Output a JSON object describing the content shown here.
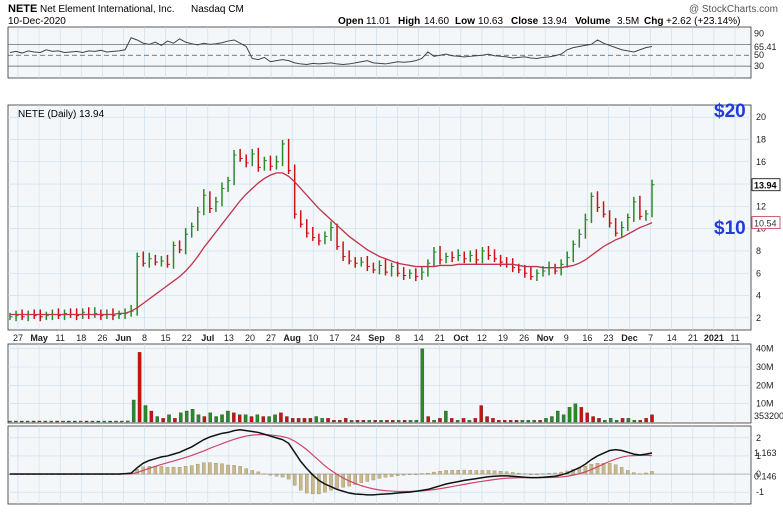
{
  "header": {
    "symbol": "NETE",
    "company": "Net Element International, Inc.",
    "exchange": "Nasdaq CM",
    "date": "10-Dec-2020",
    "open_label": "Open",
    "open": "11.01",
    "high_label": "High",
    "high": "14.60",
    "low_label": "Low",
    "low": "10.63",
    "close_label": "Close",
    "close": "13.94",
    "volume_label": "Volume",
    "volume": "3.5M",
    "chg_label": "Chg",
    "chg": "+2.62 (+23.14%)",
    "brand": "@ StockCharts.com"
  },
  "colors": {
    "up": "#2a8a2a",
    "down": "#cc1111",
    "ma": "#c0334a",
    "panel_bg": "#f4f7fa",
    "annotation": "#1f3bd8",
    "macd_line": "#111111",
    "signal_line": "#d1436a",
    "hist": "#c9b98a"
  },
  "chart_data": [
    {
      "type": "line",
      "panel": "rsi",
      "y_ticks": [
        "90",
        "65.41",
        "50",
        "30"
      ],
      "ylim": [
        10,
        100
      ],
      "current": 65.41,
      "ref_lines": [
        70,
        50,
        30
      ],
      "series": [
        {
          "values": [
            55,
            57,
            54,
            58,
            56,
            55,
            60,
            57,
            58,
            55,
            56,
            57,
            55,
            58,
            57,
            59,
            56,
            57,
            58,
            60,
            82,
            78,
            72,
            70,
            74,
            68,
            76,
            72,
            80,
            74,
            71,
            69,
            72,
            70,
            71,
            73,
            76,
            78,
            72,
            66,
            44,
            42,
            46,
            38,
            40,
            42,
            40,
            36,
            34,
            33,
            35,
            34,
            35,
            36,
            34,
            33,
            34,
            36,
            38,
            40,
            36,
            35,
            34,
            36,
            38,
            37,
            38,
            40,
            44,
            56,
            48,
            50,
            52,
            49,
            48,
            47,
            48,
            49,
            50,
            52,
            49,
            48,
            47,
            45,
            46,
            47,
            45,
            44,
            46,
            47,
            49,
            52,
            60,
            64,
            66,
            68,
            70,
            78,
            72,
            68,
            64,
            60,
            58,
            56,
            60,
            64,
            66
          ]
        }
      ]
    },
    {
      "type": "candlestick",
      "panel": "price",
      "legend": "NETE (Daily) 13.94",
      "y_ticks": [
        2,
        4,
        6,
        8,
        10,
        12,
        14,
        16,
        18,
        20
      ],
      "ylim": [
        1,
        21
      ],
      "current_price": 13.94,
      "ma_value_label": "10.54",
      "annotations": [
        "$20",
        "$10"
      ],
      "x_tick_labels": [
        "27",
        "May",
        "11",
        "18",
        "26",
        "Jun",
        "8",
        "15",
        "22",
        "Jul",
        "13",
        "20",
        "27",
        "Aug",
        "10",
        "17",
        "24",
        "Sep",
        "8",
        "14",
        "21",
        "Oct",
        "12",
        "19",
        "26",
        "Nov",
        "9",
        "16",
        "23",
        "Dec",
        "7",
        "14",
        "21",
        "2021",
        "11"
      ],
      "close": [
        2.1,
        2.2,
        2.1,
        2.3,
        2.2,
        2.1,
        2.2,
        2.3,
        2.2,
        2.4,
        2.3,
        2.2,
        2.5,
        2.3,
        2.4,
        2.2,
        2.3,
        2.2,
        2.3,
        2.4,
        2.6,
        7.5,
        6.9,
        7.3,
        7.0,
        7.1,
        6.8,
        8.5,
        8.1,
        9.5,
        10.2,
        11.5,
        13.0,
        11.8,
        12.4,
        13.6,
        14.3,
        16.6,
        16.3,
        15.9,
        16.7,
        15.5,
        16.1,
        15.6,
        16.0,
        17.6,
        15.2,
        11.3,
        10.4,
        9.6,
        9.2,
        8.9,
        9.3,
        10.1,
        8.4,
        7.5,
        7.1,
        6.9,
        7.0,
        6.6,
        6.3,
        6.7,
        6.1,
        6.6,
        6.0,
        5.8,
        6.0,
        5.7,
        6.1,
        6.9,
        7.9,
        7.2,
        7.5,
        7.4,
        7.6,
        7.3,
        7.6,
        7.2,
        8.0,
        7.6,
        7.3,
        7.0,
        6.8,
        6.5,
        6.3,
        6.0,
        5.7,
        6.0,
        6.2,
        6.5,
        6.2,
        6.8,
        7.4,
        8.6,
        9.5,
        10.8,
        12.9,
        11.9,
        11.3,
        10.5,
        9.6,
        10.1,
        11.0,
        12.4,
        11.1,
        11.32,
        13.94
      ],
      "ma": [
        2.3,
        2.3,
        2.3,
        2.3,
        2.3,
        2.3,
        2.3,
        2.3,
        2.3,
        2.3,
        2.3,
        2.3,
        2.3,
        2.3,
        2.3,
        2.3,
        2.3,
        2.3,
        2.4,
        2.4,
        2.6,
        2.9,
        3.3,
        3.7,
        4.1,
        4.5,
        4.9,
        5.3,
        5.7,
        6.2,
        6.8,
        7.5,
        8.3,
        9.0,
        9.7,
        10.4,
        11.1,
        11.8,
        12.5,
        13.1,
        13.6,
        14.1,
        14.5,
        14.8,
        15.0,
        15.0,
        14.7,
        14.2,
        13.6,
        13.0,
        12.4,
        11.8,
        11.3,
        10.8,
        10.3,
        9.8,
        9.3,
        8.9,
        8.5,
        8.1,
        7.8,
        7.5,
        7.3,
        7.1,
        6.9,
        6.8,
        6.7,
        6.6,
        6.6,
        6.6,
        6.6,
        6.7,
        6.7,
        6.7,
        6.8,
        6.8,
        6.8,
        6.8,
        6.8,
        6.8,
        6.8,
        6.8,
        6.8,
        6.8,
        6.7,
        6.6,
        6.6,
        6.6,
        6.5,
        6.5,
        6.5,
        6.5,
        6.6,
        6.7,
        6.9,
        7.2,
        7.6,
        8.0,
        8.4,
        8.7,
        9.0,
        9.2,
        9.5,
        9.8,
        10.1,
        10.3,
        10.54
      ]
    },
    {
      "type": "bar",
      "panel": "volume",
      "y_ticks": [
        "40M",
        "30M",
        "20M",
        "10M"
      ],
      "ylim": [
        0,
        42
      ],
      "current_label": "353200",
      "values": [
        0.4,
        0.2,
        0.1,
        0.3,
        0.2,
        0.2,
        0.3,
        0.1,
        0.2,
        0.2,
        0.3,
        0.2,
        0.4,
        0.2,
        0.3,
        0.1,
        0.2,
        0.1,
        0.2,
        0.3,
        0.6,
        12,
        38,
        9,
        6,
        3,
        2,
        4,
        2,
        5,
        6,
        7,
        4,
        3,
        5,
        3,
        4,
        6,
        5,
        4,
        4,
        3,
        4,
        3,
        3,
        4,
        5,
        3,
        2,
        2,
        2,
        2,
        3,
        2,
        2,
        1,
        1,
        2,
        1,
        1,
        1,
        1,
        1,
        1,
        1,
        1,
        1,
        1,
        1,
        1,
        40,
        3,
        1,
        2,
        6,
        2,
        1,
        2,
        1,
        2,
        9,
        3,
        2,
        1,
        1,
        1,
        1,
        1,
        1,
        1,
        1,
        2,
        3,
        6,
        4,
        8,
        10,
        8,
        5,
        3,
        2,
        1,
        2,
        1,
        2,
        2,
        1,
        1,
        2,
        4
      ],
      "up": [
        true,
        true,
        false,
        true,
        false,
        false,
        true,
        true,
        false,
        true,
        false,
        false,
        true,
        false,
        true,
        false,
        true,
        false,
        true,
        true,
        true,
        true,
        false,
        true,
        false,
        true,
        false,
        true,
        false,
        true,
        true,
        true,
        true,
        false,
        true,
        true,
        true,
        true,
        false,
        false,
        true,
        false,
        true,
        false,
        true,
        true,
        false,
        false,
        false,
        false,
        false,
        false,
        true,
        true,
        false,
        false,
        false,
        false,
        true,
        false,
        false,
        true,
        false,
        true,
        false,
        false,
        true,
        false,
        true,
        true,
        true,
        false,
        true,
        false,
        true,
        false,
        true,
        false,
        true,
        false,
        false,
        false,
        false,
        false,
        false,
        false,
        false,
        true,
        true,
        true,
        false,
        true,
        true,
        true,
        true,
        true,
        true,
        false,
        false,
        false,
        false,
        true,
        true,
        true,
        false,
        true,
        true
      ]
    },
    {
      "type": "line",
      "panel": "macd",
      "y_ticks": [
        "2",
        "1",
        "0",
        "-1"
      ],
      "ylim": [
        -1.6,
        2.6
      ],
      "macd_label": "1.163",
      "hist_label": "0.146",
      "macd": [
        0,
        0,
        0,
        0,
        0,
        0,
        0,
        0,
        0,
        0,
        0,
        0,
        0,
        0,
        0,
        0,
        0,
        0,
        0,
        0.02,
        0.05,
        0.35,
        0.6,
        0.75,
        0.85,
        0.95,
        1.0,
        1.1,
        1.2,
        1.35,
        1.5,
        1.7,
        1.9,
        2.05,
        2.15,
        2.25,
        2.3,
        2.4,
        2.45,
        2.4,
        2.35,
        2.3,
        2.2,
        2.1,
        2.0,
        1.9,
        1.7,
        1.2,
        0.7,
        0.3,
        -0.05,
        -0.35,
        -0.55,
        -0.7,
        -0.85,
        -0.95,
        -1.05,
        -1.1,
        -1.12,
        -1.15,
        -1.15,
        -1.12,
        -1.1,
        -1.08,
        -1.05,
        -1.02,
        -1.0,
        -0.95,
        -0.9,
        -0.85,
        -0.75,
        -0.65,
        -0.55,
        -0.48,
        -0.42,
        -0.35,
        -0.3,
        -0.25,
        -0.2,
        -0.15,
        -0.12,
        -0.1,
        -0.1,
        -0.12,
        -0.15,
        -0.18,
        -0.2,
        -0.2,
        -0.18,
        -0.15,
        -0.12,
        -0.05,
        0.05,
        0.2,
        0.35,
        0.55,
        0.8,
        1.0,
        1.15,
        1.3,
        1.35,
        1.3,
        1.2,
        1.1,
        1.05,
        1.1,
        1.163
      ],
      "signal": [
        0,
        0,
        0,
        0,
        0,
        0,
        0,
        0,
        0,
        0,
        0,
        0,
        0,
        0,
        0,
        0,
        0,
        0,
        0,
        0,
        0.01,
        0.08,
        0.2,
        0.32,
        0.43,
        0.53,
        0.63,
        0.72,
        0.82,
        0.92,
        1.03,
        1.15,
        1.28,
        1.42,
        1.55,
        1.68,
        1.8,
        1.92,
        2.02,
        2.1,
        2.15,
        2.18,
        2.18,
        2.16,
        2.12,
        2.07,
        1.98,
        1.82,
        1.6,
        1.35,
        1.05,
        0.75,
        0.45,
        0.2,
        -0.02,
        -0.22,
        -0.38,
        -0.52,
        -0.64,
        -0.74,
        -0.82,
        -0.88,
        -0.92,
        -0.94,
        -0.96,
        -0.96,
        -0.96,
        -0.95,
        -0.93,
        -0.9,
        -0.86,
        -0.81,
        -0.75,
        -0.69,
        -0.63,
        -0.57,
        -0.51,
        -0.45,
        -0.4,
        -0.35,
        -0.3,
        -0.26,
        -0.23,
        -0.21,
        -0.2,
        -0.2,
        -0.2,
        -0.2,
        -0.2,
        -0.19,
        -0.18,
        -0.16,
        -0.12,
        -0.06,
        0.02,
        0.12,
        0.25,
        0.4,
        0.55,
        0.7,
        0.83,
        0.93,
        1.0,
        1.02,
        1.03,
        1.04,
        1.017
      ]
    }
  ]
}
